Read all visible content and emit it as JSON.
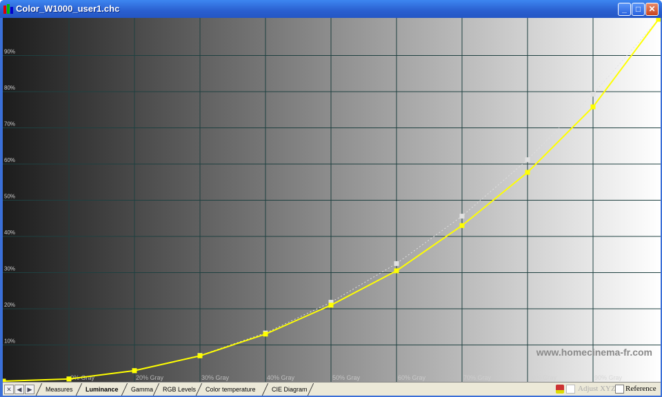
{
  "window": {
    "title": "Color_W1000_user1.chc",
    "buttons": [
      "_",
      "□",
      "✕"
    ]
  },
  "chart_data": {
    "type": "line",
    "title": "",
    "x": [
      0,
      10,
      20,
      30,
      40,
      50,
      60,
      70,
      80,
      90,
      100
    ],
    "xlim": [
      0,
      100
    ],
    "ylim": [
      0,
      100
    ],
    "x_tick_labels": [
      "",
      "0% Gray",
      "20% Gray",
      "30% Gray",
      "40% Gray",
      "50% Gray",
      "60% Gray",
      "70% Gray",
      "80% Gray",
      "90% Gray"
    ],
    "y_tick_labels": [
      "10%",
      "20%",
      "30%",
      "40%",
      "50%",
      "60%",
      "70%",
      "80%",
      "90%"
    ],
    "y_ticks": [
      10,
      20,
      30,
      40,
      50,
      60,
      70,
      80,
      90
    ],
    "grid": true,
    "background": "horizontal gray gradient dark to white",
    "series": [
      {
        "role": "measured",
        "color": "#ffff00",
        "values": [
          0,
          0.6,
          2.9,
          7.0,
          13.0,
          21.0,
          30.5,
          43.0,
          57.7,
          75.8,
          100
        ]
      },
      {
        "role": "reference",
        "color": "#e0e0e0",
        "style": "dotted",
        "values": [
          0,
          0.6,
          2.9,
          7.1,
          13.3,
          21.8,
          32.5,
          45.6,
          61.2,
          79.3,
          100
        ]
      }
    ],
    "watermark": "www.homecinema-fr.com"
  },
  "bottom": {
    "nav": [
      "✕",
      "◀",
      "▶"
    ],
    "tabs": [
      "Measures",
      "Luminance",
      "Gamma",
      "RGB Levels",
      "Color temperature",
      "CIE Diagram"
    ],
    "active_tab": "Luminance",
    "adjust_label": "Adjust XYZ",
    "reference_label": "Reference"
  }
}
